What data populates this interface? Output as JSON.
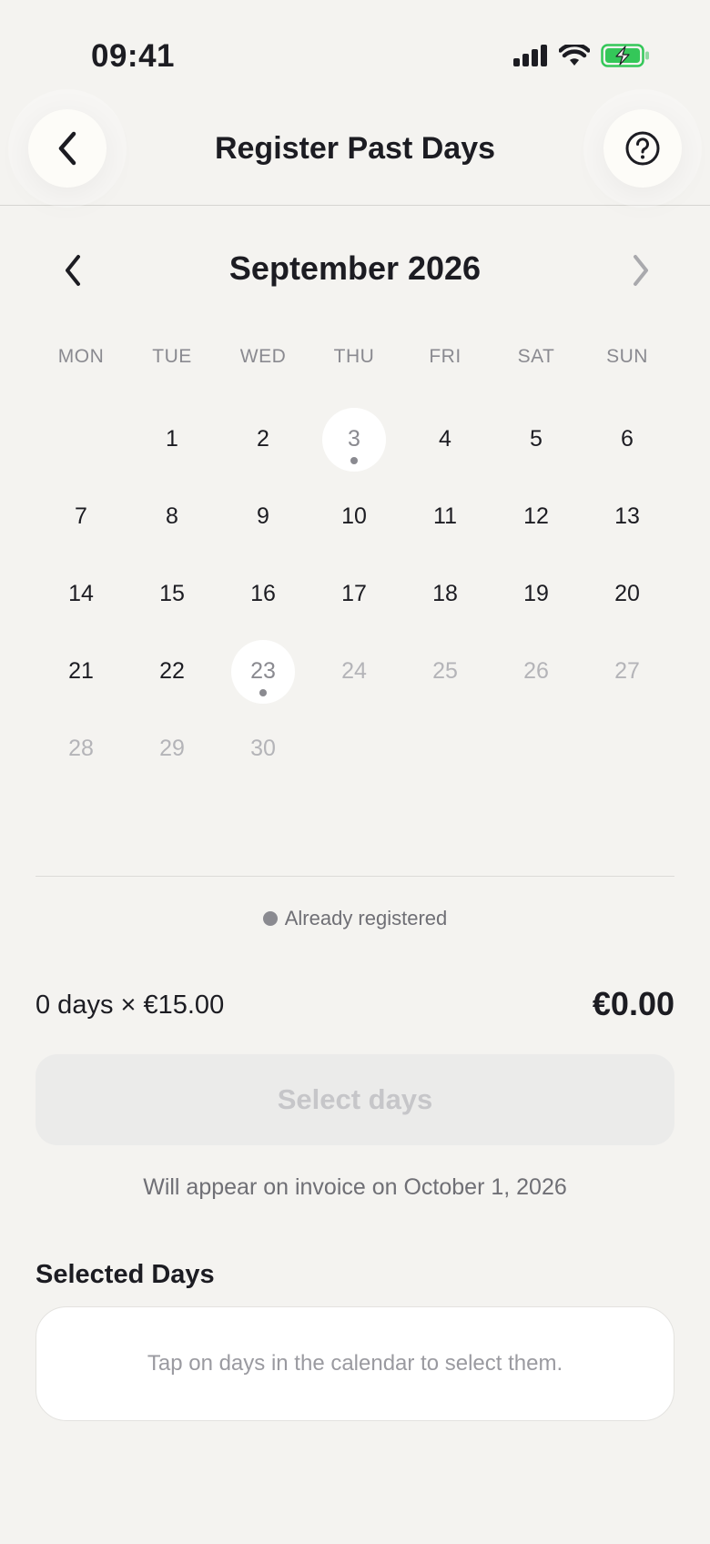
{
  "status_bar": {
    "time": "09:41",
    "icons": [
      "signal-icon",
      "wifi-icon",
      "battery-charging-icon"
    ],
    "battery_color": "#34c759"
  },
  "header": {
    "title": "Register Past Days",
    "back_icon": "chevron-left-icon",
    "help_icon": "question-circle-icon"
  },
  "calendar": {
    "month_title": "September 2026",
    "weekdays": [
      "MON",
      "TUE",
      "WED",
      "THU",
      "FRI",
      "SAT",
      "SUN"
    ],
    "leading_blanks": 1,
    "days": [
      {
        "label": "1",
        "state": "available"
      },
      {
        "label": "2",
        "state": "available"
      },
      {
        "label": "3",
        "state": "registered"
      },
      {
        "label": "4",
        "state": "available"
      },
      {
        "label": "5",
        "state": "available"
      },
      {
        "label": "6",
        "state": "available"
      },
      {
        "label": "7",
        "state": "available"
      },
      {
        "label": "8",
        "state": "available"
      },
      {
        "label": "9",
        "state": "available"
      },
      {
        "label": "10",
        "state": "available"
      },
      {
        "label": "11",
        "state": "available"
      },
      {
        "label": "12",
        "state": "available"
      },
      {
        "label": "13",
        "state": "available"
      },
      {
        "label": "14",
        "state": "available"
      },
      {
        "label": "15",
        "state": "available"
      },
      {
        "label": "16",
        "state": "available"
      },
      {
        "label": "17",
        "state": "available"
      },
      {
        "label": "18",
        "state": "available"
      },
      {
        "label": "19",
        "state": "available"
      },
      {
        "label": "20",
        "state": "available"
      },
      {
        "label": "21",
        "state": "available"
      },
      {
        "label": "22",
        "state": "available"
      },
      {
        "label": "23",
        "state": "registered"
      },
      {
        "label": "24",
        "state": "future"
      },
      {
        "label": "25",
        "state": "future"
      },
      {
        "label": "26",
        "state": "future"
      },
      {
        "label": "27",
        "state": "future"
      },
      {
        "label": "28",
        "state": "future"
      },
      {
        "label": "29",
        "state": "future"
      },
      {
        "label": "30",
        "state": "future"
      }
    ]
  },
  "legend": {
    "label": "Already registered"
  },
  "summary": {
    "calculation": "0 days × €15.00",
    "total": "€0.00"
  },
  "actions": {
    "select_label": "Select days"
  },
  "invoice_note": "Will appear on invoice on October 1, 2026",
  "selected_days": {
    "title": "Selected Days",
    "empty_text": "Tap on days in the calendar to select them."
  }
}
